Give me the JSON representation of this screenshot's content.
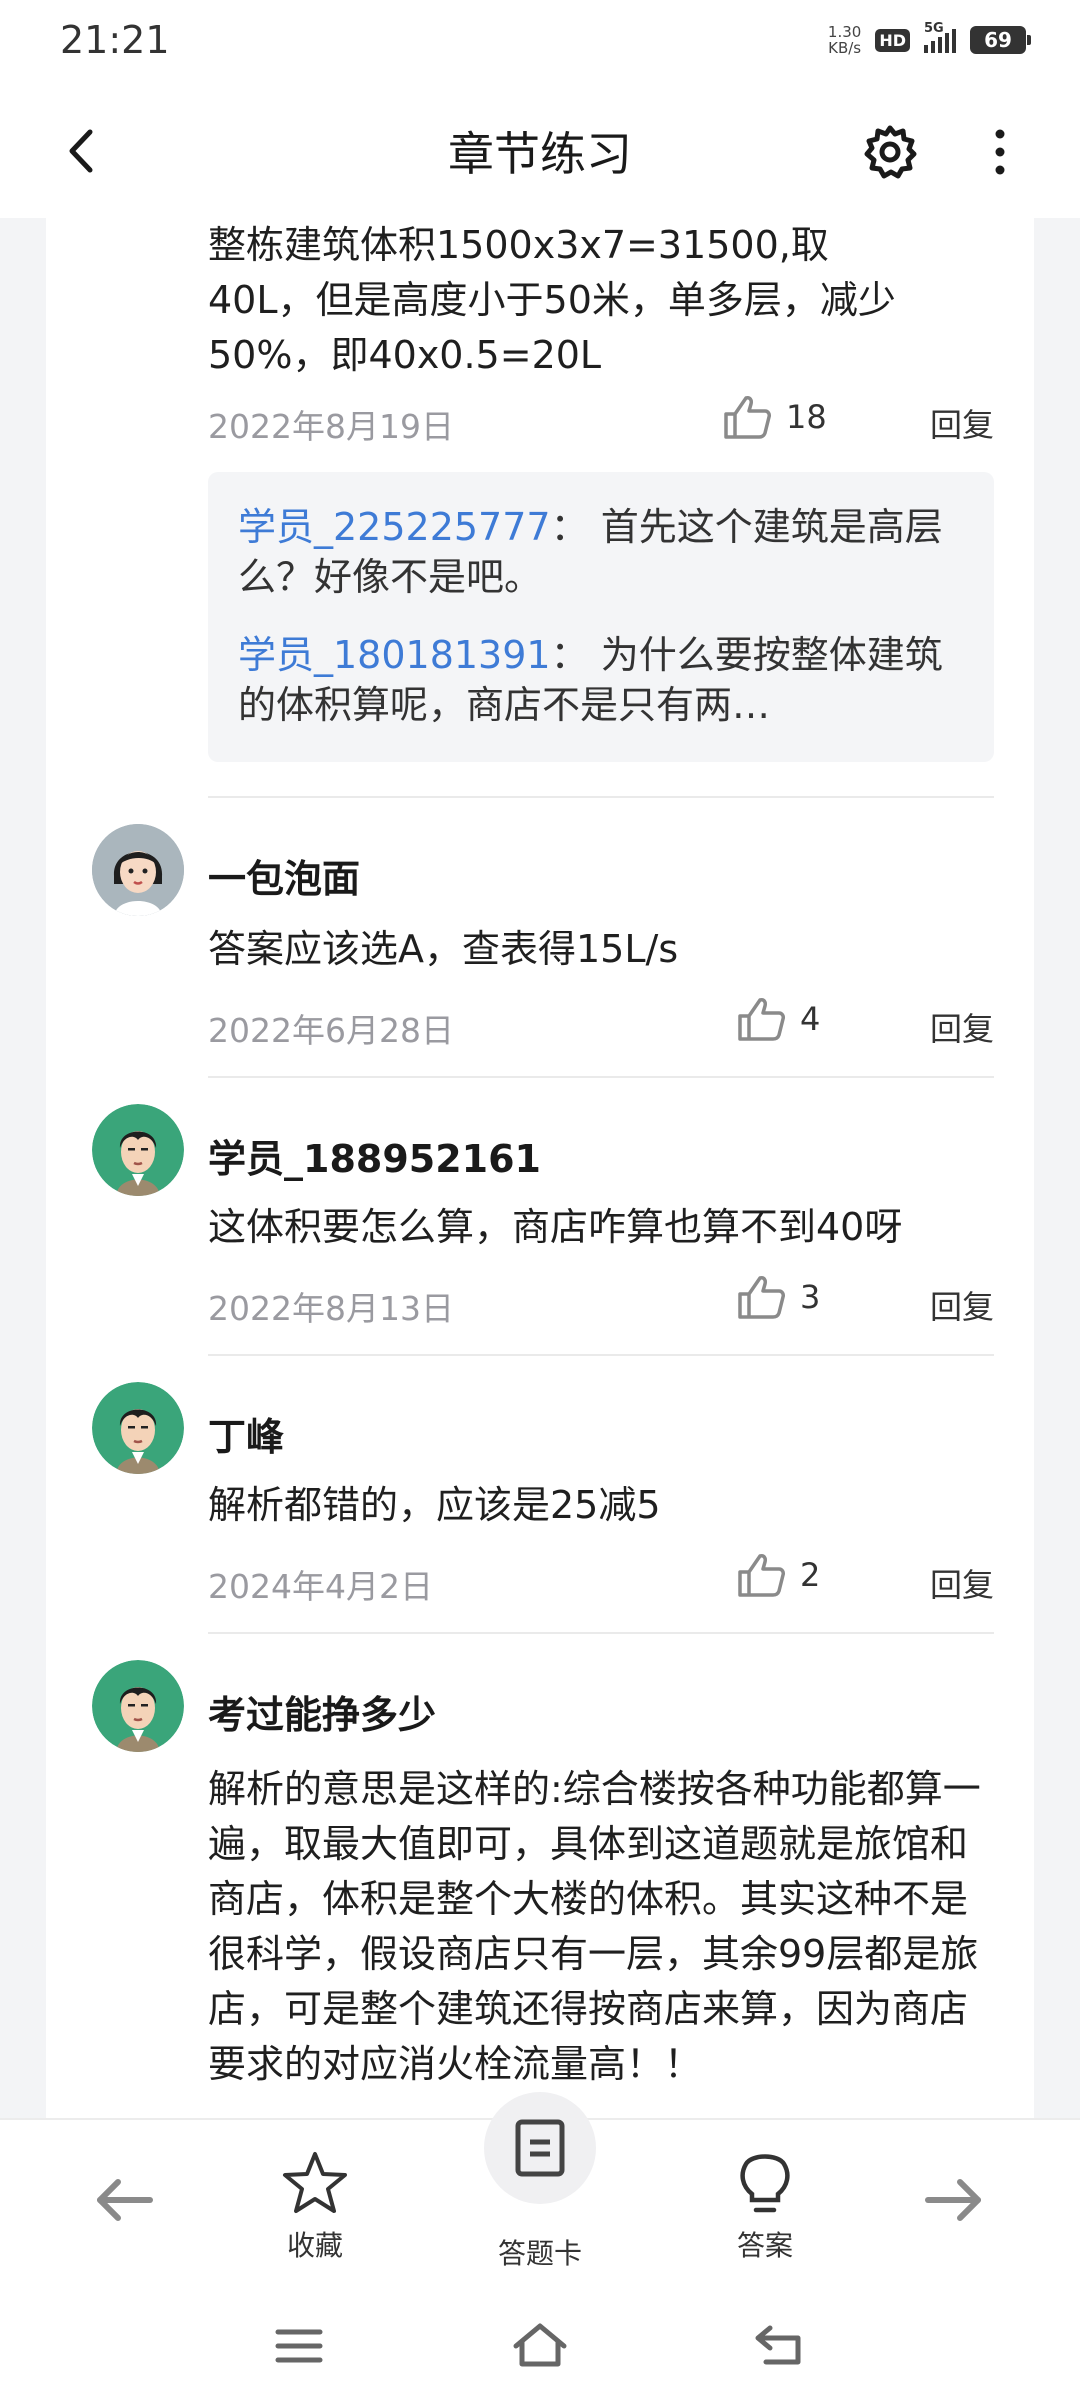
{
  "status": {
    "time": "21:21",
    "speed_value": "1.30",
    "speed_unit": "KB/s",
    "hd": "HD",
    "network": "5G",
    "battery": "69"
  },
  "header": {
    "title": "章节练习"
  },
  "first_comment": {
    "text_lines": [
      "整栋建筑体积1500x3x7=31500,取",
      "40L，但是高度小于50米，单多层，减少",
      "50%，即40x0.5=20L"
    ],
    "date": "2022年8月19日",
    "likes": "18",
    "reply_label": "回复",
    "replies": [
      {
        "user": "学员_225225777",
        "sep": "：",
        "text": "首先这个建筑是高层么？好像不是吧。"
      },
      {
        "user": "学员_180181391",
        "sep": "：",
        "text": "为什么要按整体建筑的体积算呢，商店不是只有两…"
      }
    ]
  },
  "comments": [
    {
      "name": "一包泡面",
      "text": "答案应该选A，查表得15L/s",
      "date": "2022年6月28日",
      "likes": "4",
      "reply_label": "回复"
    },
    {
      "name": "学员_188952161",
      "text": "这体积要怎么算，商店咋算也算不到40呀",
      "date": "2022年8月13日",
      "likes": "3",
      "reply_label": "回复"
    },
    {
      "name": "丁峰",
      "text": "解析都错的，应该是25减5",
      "date": "2024年4月2日",
      "likes": "2",
      "reply_label": "回复"
    },
    {
      "name": "考过能挣多少",
      "text": "解析的意思是这样的:综合楼按各种功能都算一遍，取最大值即可，具体到这道题就是旅馆和商店，体积是整个大楼的体积。其实这种不是很科学，假设商店只有一层，其余99层都是旅店，可是整个建筑还得按商店来算，因为商店要求的对应消火栓流量高！！",
      "date": "",
      "likes": "",
      "reply_label": ""
    }
  ],
  "bottom": {
    "favorite": "收藏",
    "answer_card": "答题卡",
    "answer": "答案"
  },
  "icons": {
    "back": "back-arrow-icon",
    "settings": "gear-icon",
    "more": "more-vertical-icon",
    "like": "thumbs-up-icon",
    "prev": "arrow-left-icon",
    "next": "arrow-right-icon",
    "star": "star-icon",
    "card": "document-icon",
    "bulb": "lightbulb-icon"
  },
  "colors": {
    "accent_blue": "#3e7bd6",
    "avatar_green": "#3aa57a",
    "date_gray": "#9a9aa0"
  }
}
